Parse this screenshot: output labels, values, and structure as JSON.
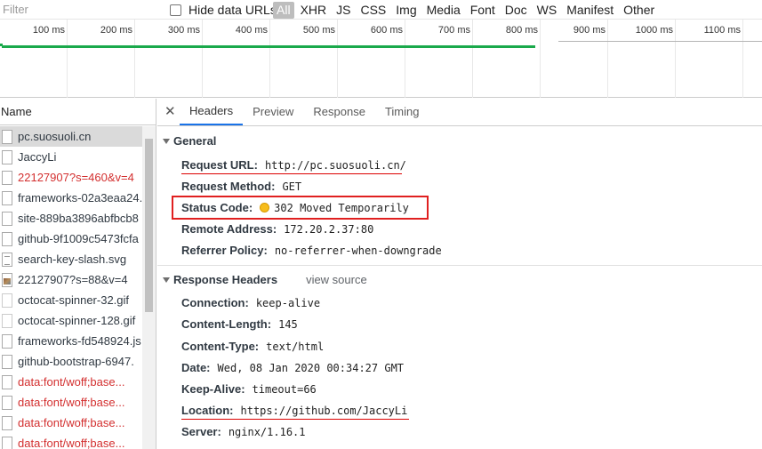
{
  "toolbar": {
    "filter_placeholder": "Filter",
    "hide_data_urls_label": "Hide data URLs",
    "type_filters": [
      "All",
      "XHR",
      "JS",
      "CSS",
      "Img",
      "Media",
      "Font",
      "Doc",
      "WS",
      "Manifest",
      "Other"
    ],
    "active_type_filter": "All"
  },
  "timeline": {
    "ticks": [
      "100 ms",
      "200 ms",
      "300 ms",
      "400 ms",
      "500 ms",
      "600 ms",
      "700 ms",
      "800 ms",
      "900 ms",
      "1000 ms",
      "1100 ms"
    ]
  },
  "requests": {
    "header": "Name",
    "items": [
      {
        "name": "pc.suosuoli.cn",
        "icon": "document-icon",
        "selected": true,
        "error": false
      },
      {
        "name": "JaccyLi",
        "icon": "document-icon",
        "selected": false,
        "error": false
      },
      {
        "name": "22127907?s=460&v=4",
        "icon": "document-icon",
        "selected": false,
        "error": true
      },
      {
        "name": "frameworks-02a3eaa24.",
        "icon": "document-icon",
        "selected": false,
        "error": false
      },
      {
        "name": "site-889ba3896abfbcb8",
        "icon": "document-icon",
        "selected": false,
        "error": false
      },
      {
        "name": "github-9f1009c5473fcfa",
        "icon": "document-icon",
        "selected": false,
        "error": false
      },
      {
        "name": "search-key-slash.svg",
        "icon": "svg-file-icon",
        "selected": false,
        "error": false
      },
      {
        "name": "22127907?s=88&v=4",
        "icon": "image-file-icon",
        "selected": false,
        "error": false
      },
      {
        "name": "octocat-spinner-32.gif",
        "icon": "gif-file-icon",
        "selected": false,
        "error": false
      },
      {
        "name": "octocat-spinner-128.gif",
        "icon": "gif-file-icon",
        "selected": false,
        "error": false
      },
      {
        "name": "frameworks-fd548924.js",
        "icon": "document-icon",
        "selected": false,
        "error": false
      },
      {
        "name": "github-bootstrap-6947.",
        "icon": "document-icon",
        "selected": false,
        "error": false
      },
      {
        "name": "data:font/woff;base...",
        "icon": "document-icon",
        "selected": false,
        "error": true
      },
      {
        "name": "data:font/woff;base...",
        "icon": "document-icon",
        "selected": false,
        "error": true
      },
      {
        "name": "data:font/woff;base...",
        "icon": "document-icon",
        "selected": false,
        "error": true
      },
      {
        "name": "data:font/woff;base...",
        "icon": "document-icon",
        "selected": false,
        "error": true
      }
    ]
  },
  "details": {
    "tabs": [
      "Headers",
      "Preview",
      "Response",
      "Timing"
    ],
    "active_tab": "Headers",
    "general": {
      "title": "General",
      "rows": [
        {
          "key": "Request URL:",
          "value": "http://pc.suosuoli.cn/"
        },
        {
          "key": "Request Method:",
          "value": "GET"
        },
        {
          "key": "Status Code:",
          "value": "302 Moved Temporarily"
        },
        {
          "key": "Remote Address:",
          "value": "172.20.2.37:80"
        },
        {
          "key": "Referrer Policy:",
          "value": "no-referrer-when-downgrade"
        }
      ]
    },
    "response_headers": {
      "title": "Response Headers",
      "view_source": "view source",
      "rows": [
        {
          "key": "Connection:",
          "value": "keep-alive"
        },
        {
          "key": "Content-Length:",
          "value": "145"
        },
        {
          "key": "Content-Type:",
          "value": "text/html"
        },
        {
          "key": "Date:",
          "value": "Wed, 08 Jan 2020 00:34:27 GMT"
        },
        {
          "key": "Keep-Alive:",
          "value": "timeout=66"
        },
        {
          "key": "Location:",
          "value": "https://github.com/JaccyLi"
        },
        {
          "key": "Server:",
          "value": "nginx/1.16.1"
        }
      ]
    }
  },
  "colors": {
    "error_text": "#d32f2f",
    "timeline_bar": "#1aa94b",
    "status_warning": "#f7bd1b",
    "annotation_red": "#e02020",
    "active_tab_underline": "#1a73e8"
  }
}
